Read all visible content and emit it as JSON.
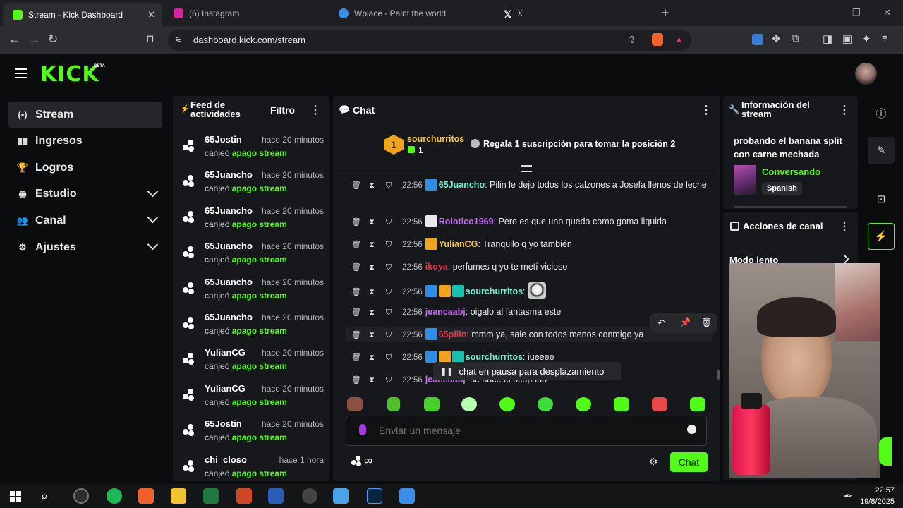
{
  "browser": {
    "tabs": [
      {
        "title": "Stream - Kick Dashboard",
        "color": "#53fc18",
        "active": true
      },
      {
        "title": "(6) Instagram",
        "color": "#d6249f"
      },
      {
        "title": "Wplace - Paint the world",
        "color": "#3b8ee8"
      },
      {
        "title": "X",
        "color": "#ffffff"
      }
    ],
    "new_tab": "+",
    "url": "dashboard.kick.com/stream",
    "close_glyph": "✕"
  },
  "header": {
    "logo": "KICK",
    "beta": "BETA",
    "menu_icon": "hamburger-icon"
  },
  "sidebar": {
    "items": [
      {
        "label": "Stream",
        "icon": "(•)",
        "active": true
      },
      {
        "label": "Ingresos",
        "icon": "▮▮"
      },
      {
        "label": "Logros",
        "icon": "🏆"
      },
      {
        "label": "Estudio",
        "icon": "◉",
        "chevron": true
      },
      {
        "label": "Canal",
        "icon": "👥",
        "chevron": true
      },
      {
        "label": "Ajustes",
        "icon": "⚙",
        "chevron": true
      }
    ]
  },
  "feed": {
    "title": "Feed de actividades",
    "filter": "Filtro",
    "items": [
      {
        "user": "65Jostin",
        "time": "hace 20 minutos",
        "desc": "canjeó",
        "reward": "apago stream"
      },
      {
        "user": "65Juancho",
        "time": "hace 20 minutos",
        "desc": "canjeó",
        "reward": "apago stream"
      },
      {
        "user": "65Juancho",
        "time": "hace 20 minutos",
        "desc": "canjeó",
        "reward": "apago stream"
      },
      {
        "user": "65Juancho",
        "time": "hace 20 minutos",
        "desc": "canjeó",
        "reward": "apago stream"
      },
      {
        "user": "65Juancho",
        "time": "hace 20 minutos",
        "desc": "canjeó",
        "reward": "apago stream"
      },
      {
        "user": "65Juancho",
        "time": "hace 20 minutos",
        "desc": "canjeó",
        "reward": "apago stream"
      },
      {
        "user": "YulianCG",
        "time": "hace 20 minutos",
        "desc": "canjeó",
        "reward": "apago stream"
      },
      {
        "user": "YulianCG",
        "time": "hace 20 minutos",
        "desc": "canjeó",
        "reward": "apago stream"
      },
      {
        "user": "65Jostin",
        "time": "hace 20 minutos",
        "desc": "canjeó",
        "reward": "apago stream"
      },
      {
        "user": "chi_closo",
        "time": "hace 1 hora",
        "desc": "canjeó",
        "reward": "apago stream"
      }
    ]
  },
  "chat": {
    "title": "Chat",
    "pinned": {
      "rank": "1",
      "user": "sourchurritos",
      "subs": "1",
      "cta": "Regala 1 suscripción para tomar la posición 2"
    },
    "messages": [
      {
        "time": "22:56",
        "user": "65Juancho",
        "color": "#6cf0d2",
        "text": "Pilin le dejo todos los calzones a Josefa llenos de leche",
        "badges": [
          "#2e8be6"
        ]
      },
      {
        "time": "22:56",
        "user": "Rolotico1969",
        "color": "#c565f5",
        "text": "Pero es que uno queda como goma liquida",
        "badges": [
          "#e8e8e8"
        ]
      },
      {
        "time": "22:56",
        "user": "YulianCG",
        "color": "#f5c445",
        "text": "Tranquilo q yo también",
        "badges": [
          "#f0a31c"
        ]
      },
      {
        "time": "22:56",
        "user": "ikoya",
        "color": "#e8334b",
        "text": "perfumes q yo te metí vicioso",
        "badges": []
      },
      {
        "time": "22:56",
        "user": "sourchurritos",
        "color": "#6cf0d2",
        "text": "",
        "badges": [
          "#2e8be6",
          "#f0a31c",
          "#16c0b0"
        ]
      },
      {
        "time": "22:56",
        "user": "jeancaabj",
        "color": "#c565f5",
        "text": "oigalo al fantasma este",
        "badges": []
      },
      {
        "time": "22:56",
        "user": "65pilin",
        "color": "#e8334b",
        "text": "mmm ya, sale con todos menos conmigo ya",
        "badges": [
          "#2e8be6"
        ]
      },
      {
        "time": "22:56",
        "user": "sourchurritos",
        "color": "#6cf0d2",
        "text": "iueeee",
        "badges": [
          "#2e8be6",
          "#f0a31c",
          "#16c0b0"
        ]
      },
      {
        "time": "22:56",
        "user": "jeancaabj",
        "color": "#c565f5",
        "text": "se hace el ocupado",
        "badges": []
      }
    ],
    "paused": "chat en pausa para desplazamiento",
    "placeholder": "Enviar un mensaje",
    "send": "Chat",
    "infinity": "∞"
  },
  "info": {
    "title": "Información del stream",
    "stream_title": "probando el banana split con carne mechada",
    "category": "Conversando",
    "language": "Spanish"
  },
  "actions": {
    "title": "Acciones de canal",
    "slow_mode": "Modo lento"
  },
  "taskbar": {
    "time": "22:57",
    "date": "19/8/2025"
  }
}
